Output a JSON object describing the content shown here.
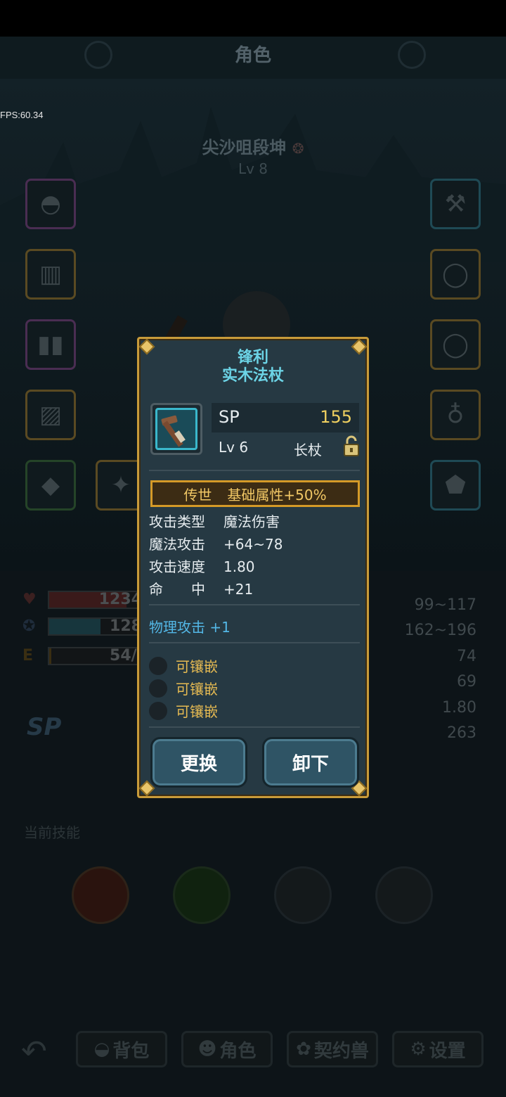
{
  "debug": {
    "fps": "FPS:60.34"
  },
  "header": {
    "title": "角色"
  },
  "character": {
    "name": "尖沙咀段坤",
    "level": "Lv 8"
  },
  "stats": {
    "hp": "1234/",
    "mp": "128/",
    "energy_label": "E",
    "energy": "54/5",
    "right_values": [
      "99~117",
      "162~196",
      "74",
      "69",
      "1.80",
      "263"
    ]
  },
  "sp_label": "SP",
  "skills_label": "当前技能",
  "nav": {
    "bag": "背包",
    "character": "角色",
    "pet": "契约兽",
    "settings": "设置"
  },
  "popup": {
    "title_line1": "锋利",
    "title_line2": "实木法杖",
    "sp_label": "SP",
    "sp_value": "155",
    "level": "Lv 6",
    "type": "长杖",
    "rarity": "传世",
    "rarity_bonus": "基础属性+50%",
    "attributes": [
      {
        "key": "攻击类型",
        "value": "魔法伤害"
      },
      {
        "key": "魔法攻击",
        "value": "+64~78"
      },
      {
        "key": "攻击速度",
        "value": "1.80"
      },
      {
        "key": "命　　中",
        "value": "+21"
      }
    ],
    "bonus": "物理攻击 +1",
    "sockets": [
      "可镶嵌",
      "可镶嵌",
      "可镶嵌"
    ],
    "replace_button": "更换",
    "unequip_button": "卸下"
  },
  "colors": {
    "popup_bg": "#263943",
    "popup_border": "#c89b3a",
    "title_cyan": "#6cd4e6",
    "sp_gold": "#f0d060",
    "bonus_blue": "#53b7e6",
    "socket_gold": "#e6ba52"
  }
}
